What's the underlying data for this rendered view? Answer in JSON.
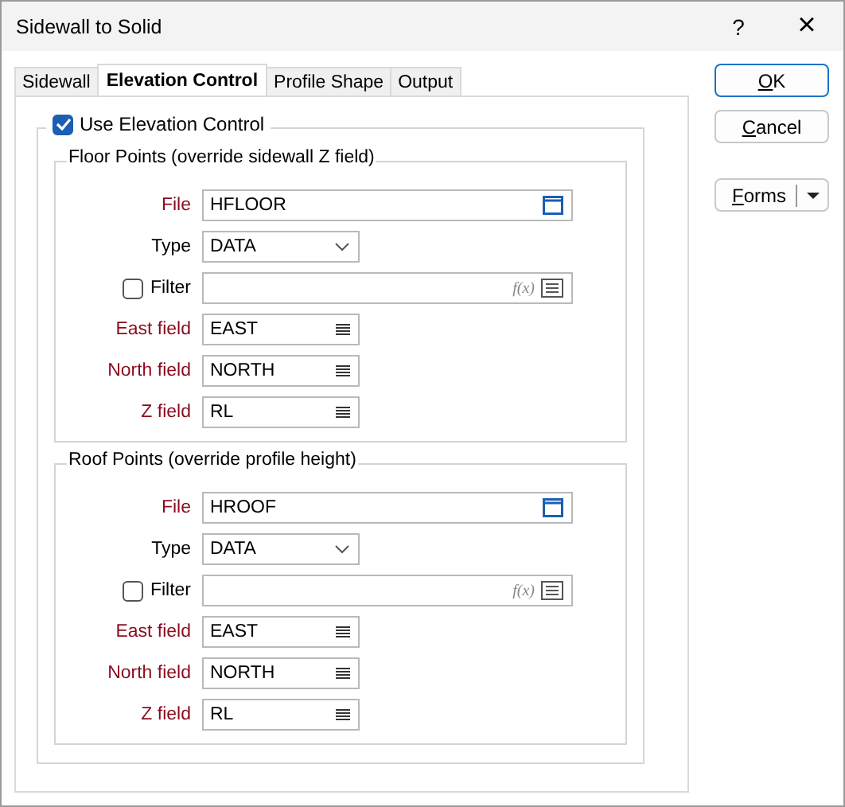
{
  "window": {
    "title": "Sidewall to Solid",
    "help": "?",
    "close": "×"
  },
  "tabs": [
    {
      "label": "Sidewall",
      "selected": false
    },
    {
      "label": "Elevation Control",
      "selected": true
    },
    {
      "label": "Profile Shape",
      "selected": false
    },
    {
      "label": "Output",
      "selected": false
    }
  ],
  "use_elevation_control": {
    "label": "Use Elevation Control",
    "checked": true
  },
  "groups": [
    {
      "title": "Floor Points (override sidewall Z field)",
      "rows": [
        {
          "kind": "file",
          "label": "File",
          "required": true,
          "value": "HFLOOR"
        },
        {
          "kind": "dropdown",
          "label": "Type",
          "required": false,
          "value": "DATA"
        },
        {
          "kind": "filter",
          "label": "Filter",
          "checked": false,
          "fx": "f(x)"
        },
        {
          "kind": "field",
          "label": "East field",
          "required": true,
          "value": "EAST"
        },
        {
          "kind": "field",
          "label": "North field",
          "required": true,
          "value": "NORTH"
        },
        {
          "kind": "field",
          "label": "Z field",
          "required": true,
          "value": "RL"
        }
      ]
    },
    {
      "title": "Roof Points (override profile height)",
      "rows": [
        {
          "kind": "file",
          "label": "File",
          "required": true,
          "value": "HROOF"
        },
        {
          "kind": "dropdown",
          "label": "Type",
          "required": false,
          "value": "DATA"
        },
        {
          "kind": "filter",
          "label": "Filter",
          "checked": false,
          "fx": "f(x)"
        },
        {
          "kind": "field",
          "label": "East field",
          "required": true,
          "value": "EAST"
        },
        {
          "kind": "field",
          "label": "North field",
          "required": true,
          "value": "NORTH"
        },
        {
          "kind": "field",
          "label": "Z field",
          "required": true,
          "value": "RL"
        }
      ]
    }
  ],
  "buttons": [
    {
      "kind": "default",
      "label": "OK"
    },
    {
      "kind": "plain",
      "label": "Cancel"
    },
    {
      "kind": "split",
      "label": "Forms"
    }
  ]
}
